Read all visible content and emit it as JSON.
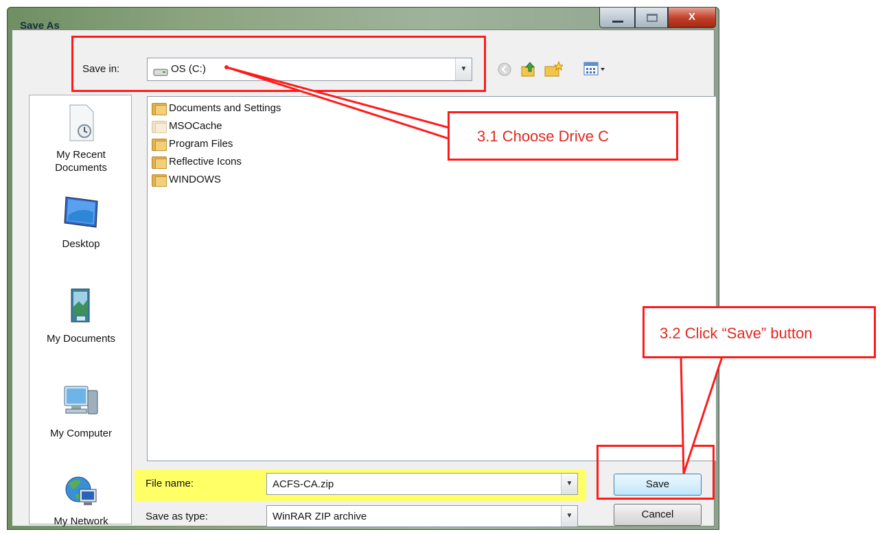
{
  "window": {
    "title": "Save As",
    "close_glyph": "X"
  },
  "toolbar": {
    "save_in_label": "Save in:",
    "location": "OS (C:)",
    "icons": [
      "back-icon",
      "up-folder-icon",
      "new-folder-icon",
      "view-menu-icon"
    ]
  },
  "places": [
    {
      "label": "My Recent Documents",
      "icon": "recent-documents-icon"
    },
    {
      "label": "Desktop",
      "icon": "desktop-icon"
    },
    {
      "label": "My Documents",
      "icon": "my-documents-icon"
    },
    {
      "label": "My Computer",
      "icon": "my-computer-icon"
    },
    {
      "label": "My Network",
      "icon": "my-network-icon"
    }
  ],
  "files": [
    {
      "name": "Documents and Settings"
    },
    {
      "name": "MSOCache"
    },
    {
      "name": "Program Files"
    },
    {
      "name": "Reflective Icons"
    },
    {
      "name": "WINDOWS"
    }
  ],
  "form": {
    "file_name_label": "File name:",
    "file_name_value": "ACFS-CA.zip",
    "type_label": "Save as type:",
    "type_value": "WinRAR ZIP archive"
  },
  "buttons": {
    "save": "Save",
    "cancel": "Cancel"
  },
  "annotations": {
    "step1": "3.1 Choose Drive C",
    "step2": "3.2 Click “Save” button",
    "accent_color": "#ff1a1a",
    "highlight_color": "#ffff66"
  }
}
